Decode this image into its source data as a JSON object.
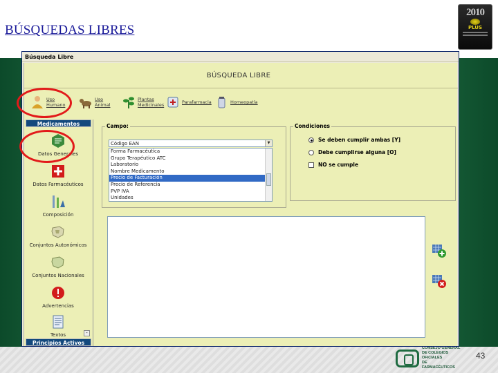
{
  "slide": {
    "title": "BÚSQUEDAS LIBRES",
    "page_number": "43",
    "logo": {
      "big_text": "2010",
      "sub_text": "PLUS"
    },
    "footer_org_lines": [
      "CONSEJO GENERAL",
      "DE COLEGIOS OFICIALES",
      "DE FARMACÉUTICOS"
    ]
  },
  "window": {
    "title": "Búsqueda Libre",
    "heading": "BÚSQUEDA LIBRE"
  },
  "toolbar": {
    "items": [
      {
        "label": "Uso\nHumano",
        "icon": "human-use-icon"
      },
      {
        "label": "Uso\nAnimal",
        "icon": "animal-use-icon"
      },
      {
        "label": "Plantas\nMedicinales",
        "icon": "plant-icon"
      },
      {
        "label": "Parafarmacia",
        "icon": "parapharmacy-icon"
      },
      {
        "label": "Homeopatía",
        "icon": "homeopathy-icon"
      }
    ]
  },
  "sidebar": {
    "header": "Medicamentos",
    "footer_header": "Principios Activos",
    "items": [
      {
        "label": "Datos Generales",
        "icon": "general-data-icon"
      },
      {
        "label": "Datos Farmacéuticos",
        "icon": "pharma-data-icon"
      },
      {
        "label": "Composición",
        "icon": "composition-icon"
      },
      {
        "label": "Conjuntos Autonómicos",
        "icon": "regional-sets-icon"
      },
      {
        "label": "Conjuntos Nacionales",
        "icon": "national-sets-icon"
      },
      {
        "label": "Advertencias",
        "icon": "warning-icon"
      },
      {
        "label": "Textos",
        "icon": "texts-icon"
      }
    ],
    "collapse_label": "-"
  },
  "campo": {
    "title": "Campo:",
    "selected_value": "Código EAN",
    "options": [
      "Forma Farmacéutica",
      "Grupo Terapéutico ATC",
      "Laboratorio",
      "Nombre Medicamento",
      "Precio de Facturación",
      "Precio de Referencia",
      "PVP IVA",
      "Unidades"
    ],
    "selected_option_index": 4
  },
  "condiciones": {
    "title": "Condiciones",
    "options": [
      {
        "label": "Se deben cumplir ambas [Y]",
        "type": "radio",
        "checked": true
      },
      {
        "label": "Debe cumplirse alguna [O]",
        "type": "radio",
        "checked": false
      },
      {
        "label": "NO se cumple",
        "type": "checkbox",
        "checked": false
      }
    ]
  },
  "actions": {
    "add_icon": "add-condition-icon",
    "remove_icon": "remove-condition-icon"
  },
  "colors": {
    "highlight_oval": "#e21a1a",
    "sidebar_header": "#13497d",
    "selection": "#316ac5",
    "window_background": "#ecefb6"
  }
}
